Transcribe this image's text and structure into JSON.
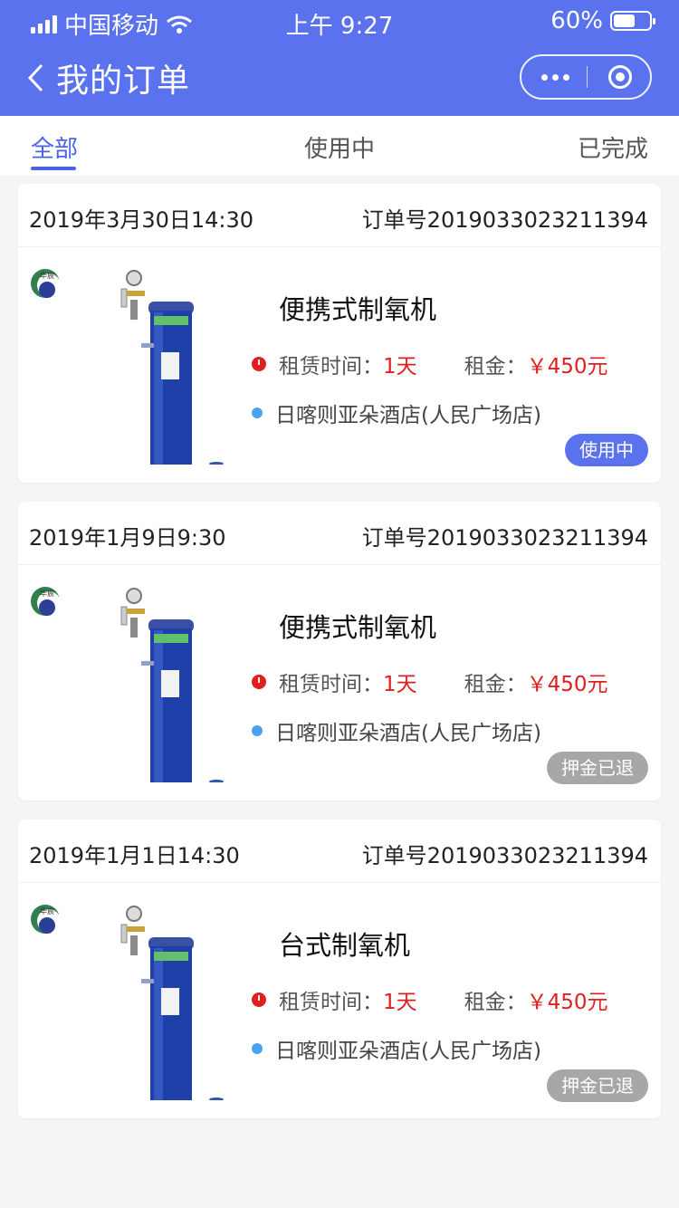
{
  "status_bar": {
    "carrier": "中国移动",
    "time": "上午 9:27",
    "battery": "60%",
    "battery_level": 0.6
  },
  "nav": {
    "title": "我的订单"
  },
  "tabs": [
    {
      "label": "全部"
    },
    {
      "label": "使用中"
    },
    {
      "label": "已完成"
    }
  ],
  "orders": [
    {
      "date": "2019年3月30日14:30",
      "order_no": "订单号2019033023211394",
      "product": "便携式制氧机",
      "rent_time_label": "租赁时间：",
      "rent_time_value": "1天",
      "rent_label": "租金：",
      "rent_value": "￥450元",
      "location": "日喀则亚朵酒店(人民广场店)",
      "status": "使用中",
      "status_color": "#5b72ef"
    },
    {
      "date": "2019年1月9日9:30",
      "order_no": "订单号2019033023211394",
      "product": "便携式制氧机",
      "rent_time_label": "租赁时间：",
      "rent_time_value": "1天",
      "rent_label": "租金：",
      "rent_value": "￥450元",
      "location": "日喀则亚朵酒店(人民广场店)",
      "status": "押金已退",
      "status_color": "#a7a7a7"
    },
    {
      "date": "2019年1月1日14:30",
      "order_no": "订单号2019033023211394",
      "product": "台式制氧机",
      "rent_time_label": "租赁时间：",
      "rent_time_value": "1天",
      "rent_label": "租金：",
      "rent_value": "￥450元",
      "location": "日喀则亚朵酒店(人民广场店)",
      "status": "押金已退",
      "status_color": "#a7a7a7"
    }
  ],
  "product_image": {
    "logo_text": "华宸"
  }
}
